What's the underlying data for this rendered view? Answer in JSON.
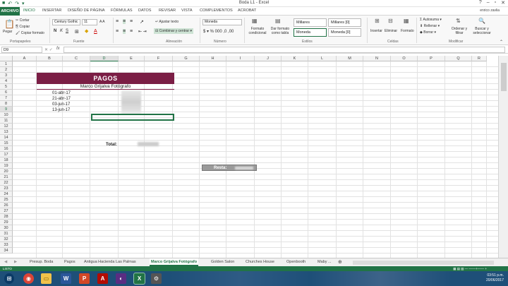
{
  "window": {
    "title": "Boda L1 - Excel",
    "user": "enrico zavlia",
    "help": "?"
  },
  "menu": {
    "file": "ARCHIVO",
    "tabs": [
      "INICIO",
      "INSERTAR",
      "DISEÑO DE PÁGINA",
      "FÓRMULAS",
      "DATOS",
      "REVISAR",
      "VISTA",
      "COMPLEMENTOS",
      "ACROBAT"
    ]
  },
  "ribbon": {
    "paste": "Pegar",
    "cut": "Cortar",
    "copy": "Copiar",
    "format_painter": "Copiar formato",
    "font_name": "Century Gothic",
    "font_size": "11",
    "wrap_text": "Ajustar texto",
    "merge_center": "Combinar y centrar",
    "number_format": "Moneda",
    "conditional": "Formato condicional",
    "table_format": "Dar formato como tabla",
    "styles": [
      "Millares",
      "Millares [0]",
      "Moneda",
      "Moneda [0]"
    ],
    "insert": "Insertar",
    "delete": "Eliminar",
    "format": "Formato",
    "autosum": "Autosuma",
    "fill": "Rellenar",
    "clear": "Borrar",
    "sort": "Ordenar y filtrar",
    "find": "Buscar y seleccionar",
    "groups": {
      "clipboard": "Portapapeles",
      "font": "Fuente",
      "alignment": "Alineación",
      "number": "Número",
      "styles": "Estilos",
      "cells": "Celdas",
      "editing": "Modificar"
    }
  },
  "formula_bar": {
    "name_box": "D9",
    "fx": "fx",
    "formula": ""
  },
  "columns": [
    "A",
    "B",
    "C",
    "D",
    "E",
    "F",
    "G",
    "H",
    "I",
    "J",
    "K",
    "L",
    "M",
    "N",
    "O",
    "P",
    "Q",
    "R"
  ],
  "rows": [
    "1",
    "2",
    "3",
    "4",
    "5",
    "6",
    "7",
    "8",
    "9",
    "10",
    "11",
    "12",
    "13",
    "14",
    "15",
    "16",
    "17",
    "18",
    "19",
    "20",
    "21",
    "22",
    "23",
    "24",
    "25",
    "26",
    "27",
    "28",
    "29",
    "30",
    "31",
    "32",
    "33",
    "34"
  ],
  "sheet": {
    "header": "PAGOS",
    "subheader": "Marco Grijalva Fotógrafo",
    "dates": [
      "01-abr-17",
      "21-abr-17",
      "03-jun-17",
      "13-jun-17"
    ],
    "total_label": "Total:",
    "result_label": "Resta:"
  },
  "sheet_tabs": [
    "Presup. Boda",
    "Pagos",
    "Antigua Hacienda Las Palmas",
    "Marco Grijalva Fotógrafo",
    "Golden Salon",
    "Churches House",
    "Openbooth",
    "Maby ..."
  ],
  "active_tab": "Marco Grijalva Fotógrafo",
  "status": {
    "mode": "LISTO"
  },
  "taskbar": {
    "time": "03:51 p.m.",
    "date": "20/06/2017"
  },
  "colors": {
    "excel_green": "#217346",
    "header_fill": "#7b1e45",
    "taskbar": "#1e4f78"
  }
}
